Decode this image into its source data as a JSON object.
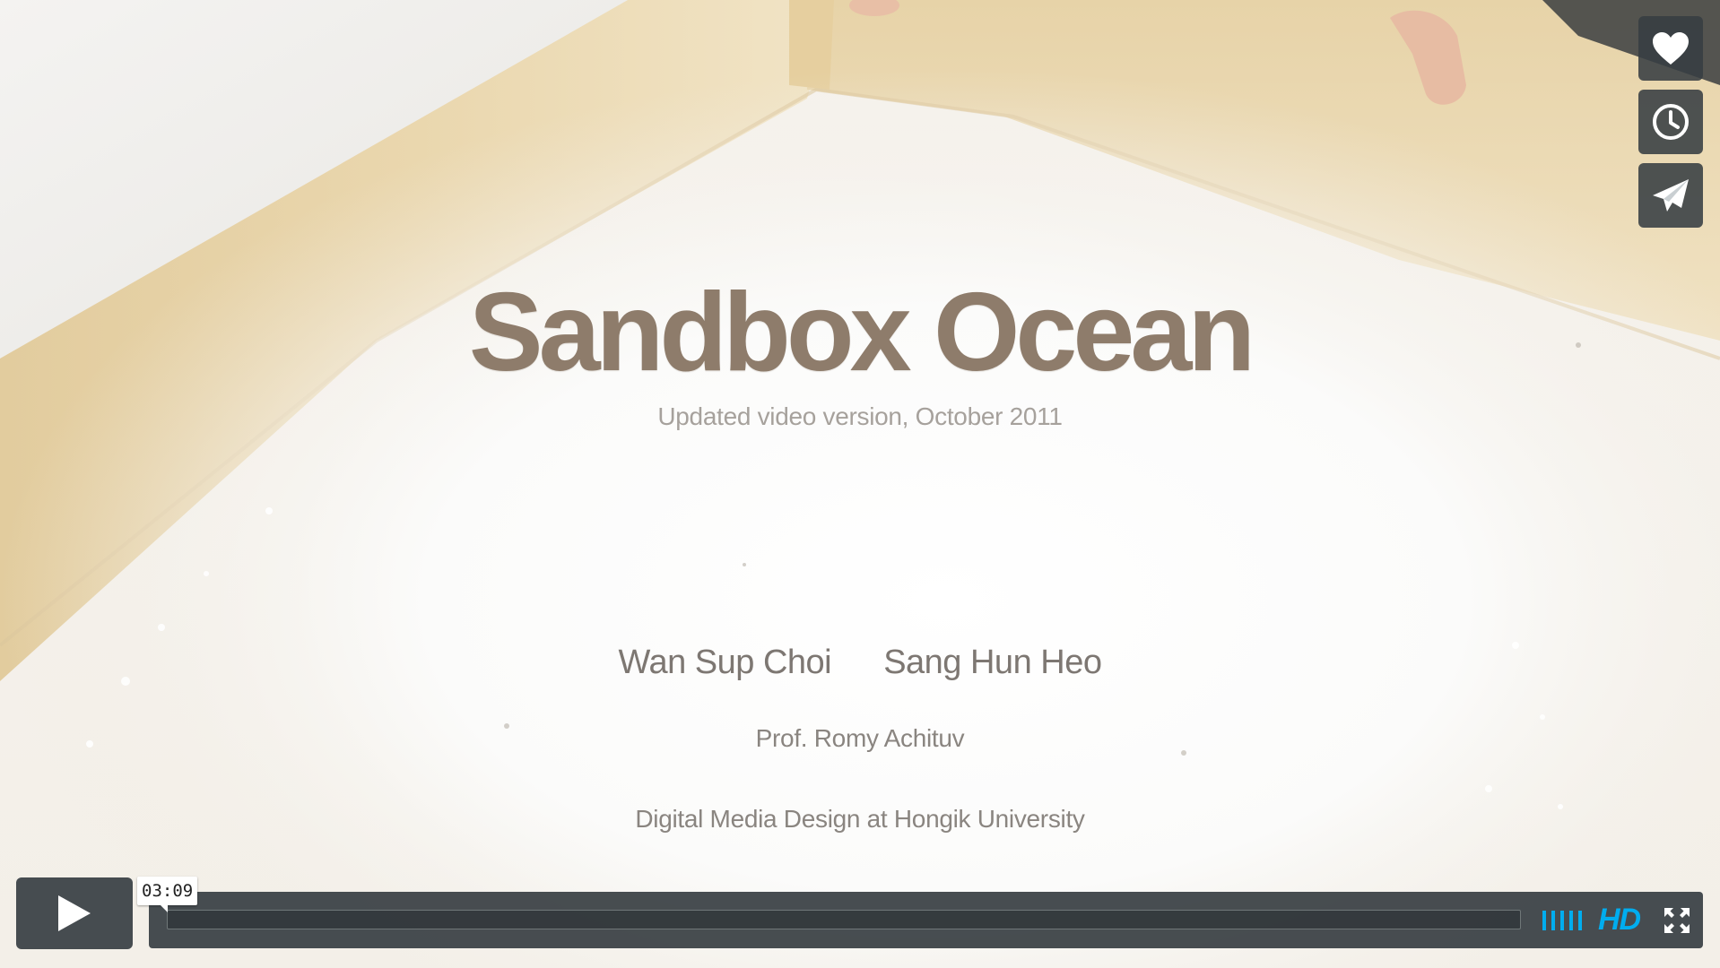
{
  "video": {
    "title": "Sandbox Ocean",
    "subtitle": "Updated video version, October 2011",
    "authors": [
      "Wan Sup Choi",
      "Sang Hun Heo"
    ],
    "professor": "Prof. Romy Achituv",
    "school": "Digital Media Design at Hongik University"
  },
  "player": {
    "time_display": "03:09",
    "progress": 0,
    "hd_label": "HD",
    "accent_color": "#00adef",
    "control_color": "#373e42"
  },
  "side_actions": [
    {
      "name": "like",
      "icon": "heart-icon"
    },
    {
      "name": "watch-later",
      "icon": "clock-icon"
    },
    {
      "name": "share",
      "icon": "paper-plane-icon"
    }
  ]
}
